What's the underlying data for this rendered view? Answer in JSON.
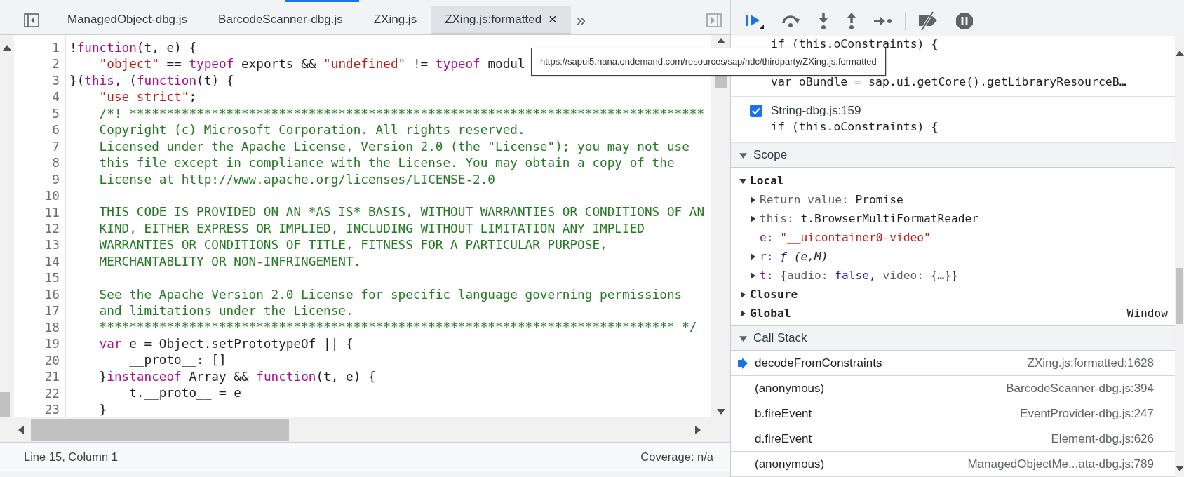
{
  "editor": {
    "tabs": [
      {
        "label": "ManagedObject-dbg.js",
        "selected": false,
        "closable": false
      },
      {
        "label": "BarcodeScanner-dbg.js",
        "selected": false,
        "closable": false
      },
      {
        "label": "ZXing.js",
        "selected": false,
        "closable": false
      },
      {
        "label": "ZXing.js:formatted",
        "selected": true,
        "closable": true
      }
    ],
    "close_glyph": "×",
    "more_glyph": "»",
    "lines": [
      {
        "number": "1",
        "segments": [
          {
            "kind": "plain",
            "text": "!"
          },
          {
            "kind": "keyword",
            "text": "function"
          },
          {
            "kind": "plain",
            "text": "(t, e) {"
          }
        ]
      },
      {
        "number": "2",
        "segments": [
          {
            "kind": "string",
            "text": "    \"object\""
          },
          {
            "kind": "plain",
            "text": " == "
          },
          {
            "kind": "keyword",
            "text": "typeof"
          },
          {
            "kind": "plain",
            "text": " exports && "
          },
          {
            "kind": "string",
            "text": "\"undefined\""
          },
          {
            "kind": "plain",
            "text": " != "
          },
          {
            "kind": "keyword",
            "text": "typeof"
          },
          {
            "kind": "plain",
            "text": " modul"
          }
        ]
      },
      {
        "number": "3",
        "segments": [
          {
            "kind": "plain",
            "text": "}("
          },
          {
            "kind": "keyword",
            "text": "this"
          },
          {
            "kind": "plain",
            "text": ", ("
          },
          {
            "kind": "keyword",
            "text": "function"
          },
          {
            "kind": "plain",
            "text": "(t) {"
          }
        ]
      },
      {
        "number": "4",
        "segments": [
          {
            "kind": "string",
            "text": "    \"use strict\""
          },
          {
            "kind": "plain",
            "text": ";"
          }
        ]
      },
      {
        "number": "5",
        "segments": [
          {
            "kind": "comment",
            "text": "    /*! *****************************************************************************"
          }
        ]
      },
      {
        "number": "6",
        "segments": [
          {
            "kind": "comment",
            "text": "    Copyright (c) Microsoft Corporation. All rights reserved."
          }
        ]
      },
      {
        "number": "7",
        "segments": [
          {
            "kind": "comment",
            "text": "    Licensed under the Apache License, Version 2.0 (the \"License\"); you may not use"
          }
        ]
      },
      {
        "number": "8",
        "segments": [
          {
            "kind": "comment",
            "text": "    this file except in compliance with the License. You may obtain a copy of the"
          }
        ]
      },
      {
        "number": "9",
        "segments": [
          {
            "kind": "comment",
            "text": "    License at http://www.apache.org/licenses/LICENSE-2.0"
          }
        ]
      },
      {
        "number": "10"
      },
      {
        "number": "11",
        "segments": [
          {
            "kind": "comment",
            "text": "    THIS CODE IS PROVIDED ON AN *AS IS* BASIS, WITHOUT WARRANTIES OR CONDITIONS OF AN"
          }
        ]
      },
      {
        "number": "12",
        "segments": [
          {
            "kind": "comment",
            "text": "    KIND, EITHER EXPRESS OR IMPLIED, INCLUDING WITHOUT LIMITATION ANY IMPLIED"
          }
        ]
      },
      {
        "number": "13",
        "segments": [
          {
            "kind": "comment",
            "text": "    WARRANTIES OR CONDITIONS OF TITLE, FITNESS FOR A PARTICULAR PURPOSE,"
          }
        ]
      },
      {
        "number": "14",
        "segments": [
          {
            "kind": "comment",
            "text": "    MERCHANTABLITY OR NON-INFRINGEMENT."
          }
        ]
      },
      {
        "number": "15"
      },
      {
        "number": "16",
        "segments": [
          {
            "kind": "comment",
            "text": "    See the Apache Version 2.0 License for specific language governing permissions"
          }
        ]
      },
      {
        "number": "17",
        "segments": [
          {
            "kind": "comment",
            "text": "    and limitations under the License."
          }
        ]
      },
      {
        "number": "18",
        "segments": [
          {
            "kind": "comment",
            "text": "    ***************************************************************************** */"
          }
        ]
      },
      {
        "number": "19",
        "segments": [
          {
            "kind": "keyword",
            "text": "    var"
          },
          {
            "kind": "plain",
            "text": " e = Object.setPrototypeOf || {"
          }
        ]
      },
      {
        "number": "20",
        "segments": [
          {
            "kind": "plain",
            "text": "        __proto__: []"
          }
        ]
      },
      {
        "number": "21",
        "segments": [
          {
            "kind": "plain",
            "text": "    }"
          },
          {
            "kind": "keyword",
            "text": "instanceof"
          },
          {
            "kind": "plain",
            "text": " Array && "
          },
          {
            "kind": "keyword",
            "text": "function"
          },
          {
            "kind": "plain",
            "text": "(t, e) {"
          }
        ]
      },
      {
        "number": "22",
        "segments": [
          {
            "kind": "plain",
            "text": "        t.__proto__ = e"
          }
        ]
      },
      {
        "number": "23",
        "segments": [
          {
            "kind": "plain",
            "text": "    }"
          }
        ]
      }
    ],
    "tooltip": "https://sapui5.hana.ondemand.com/resources/sap/ndc/thirdparty/ZXing.js:formatted",
    "status": {
      "position": "Line 15, Column 1",
      "coverage": "Coverage: n/a"
    }
  },
  "debugger": {
    "breakpoints": [
      {
        "code": "if (this.oConstraints) {"
      },
      {
        "code": "var oBundle = sap.ui.getCore().getLibraryResourceB…"
      },
      {
        "file": "String-dbg.js:159",
        "checked": true,
        "code": "if (this.oConstraints) {"
      }
    ],
    "scope": {
      "title": "Scope",
      "expanded": true,
      "groups": [
        {
          "name": "Local",
          "expanded": true,
          "items": [
            {
              "name": "Return value:",
              "kind": "internal",
              "expandable": true,
              "value": [
                {
                  "kind": "plain",
                  "text": "Promise"
                }
              ]
            },
            {
              "name": "this:",
              "kind": "internal",
              "expandable": true,
              "value": [
                {
                  "kind": "plain",
                  "text": "t.BrowserMultiFormatReader"
                }
              ]
            },
            {
              "name": "e:",
              "kind": "own",
              "expandable": false,
              "value": [
                {
                  "kind": "string",
                  "text": "\"__uicontainer0-video\""
                }
              ]
            },
            {
              "name": "r:",
              "kind": "own",
              "expandable": true,
              "value": [
                {
                  "kind": "function-sign",
                  "text": "ƒ"
                },
                {
                  "kind": "function",
                  "text": " (e,M)"
                }
              ]
            },
            {
              "name": "t:",
              "kind": "own",
              "expandable": true,
              "value": [
                {
                  "kind": "plain",
                  "text": "{"
                },
                {
                  "kind": "property",
                  "text": "audio:"
                },
                {
                  "kind": "boolean",
                  "text": " false"
                },
                {
                  "kind": "plain",
                  "text": ", "
                },
                {
                  "kind": "property",
                  "text": "video:"
                },
                {
                  "kind": "plain",
                  "text": " {…}}"
                }
              ]
            }
          ]
        },
        {
          "name": "Closure",
          "expanded": false
        },
        {
          "name": "Global",
          "expanded": false,
          "value": "Window"
        }
      ]
    },
    "call_stack": {
      "title": "Call Stack",
      "expanded": true,
      "frames": [
        {
          "name": "decodeFromConstraints",
          "location": "ZXing.js:formatted:1628",
          "selected": true
        },
        {
          "name": "(anonymous)",
          "location": "BarcodeScanner-dbg.js:394",
          "selected": false
        },
        {
          "name": "b.fireEvent",
          "location": "EventProvider-dbg.js:247",
          "selected": false
        },
        {
          "name": "d.fireEvent",
          "location": "Element-dbg.js:626",
          "selected": false
        },
        {
          "name": "(anonymous)",
          "location": "ManagedObjectMe...ata-dbg.js:789",
          "selected": false
        }
      ]
    }
  }
}
